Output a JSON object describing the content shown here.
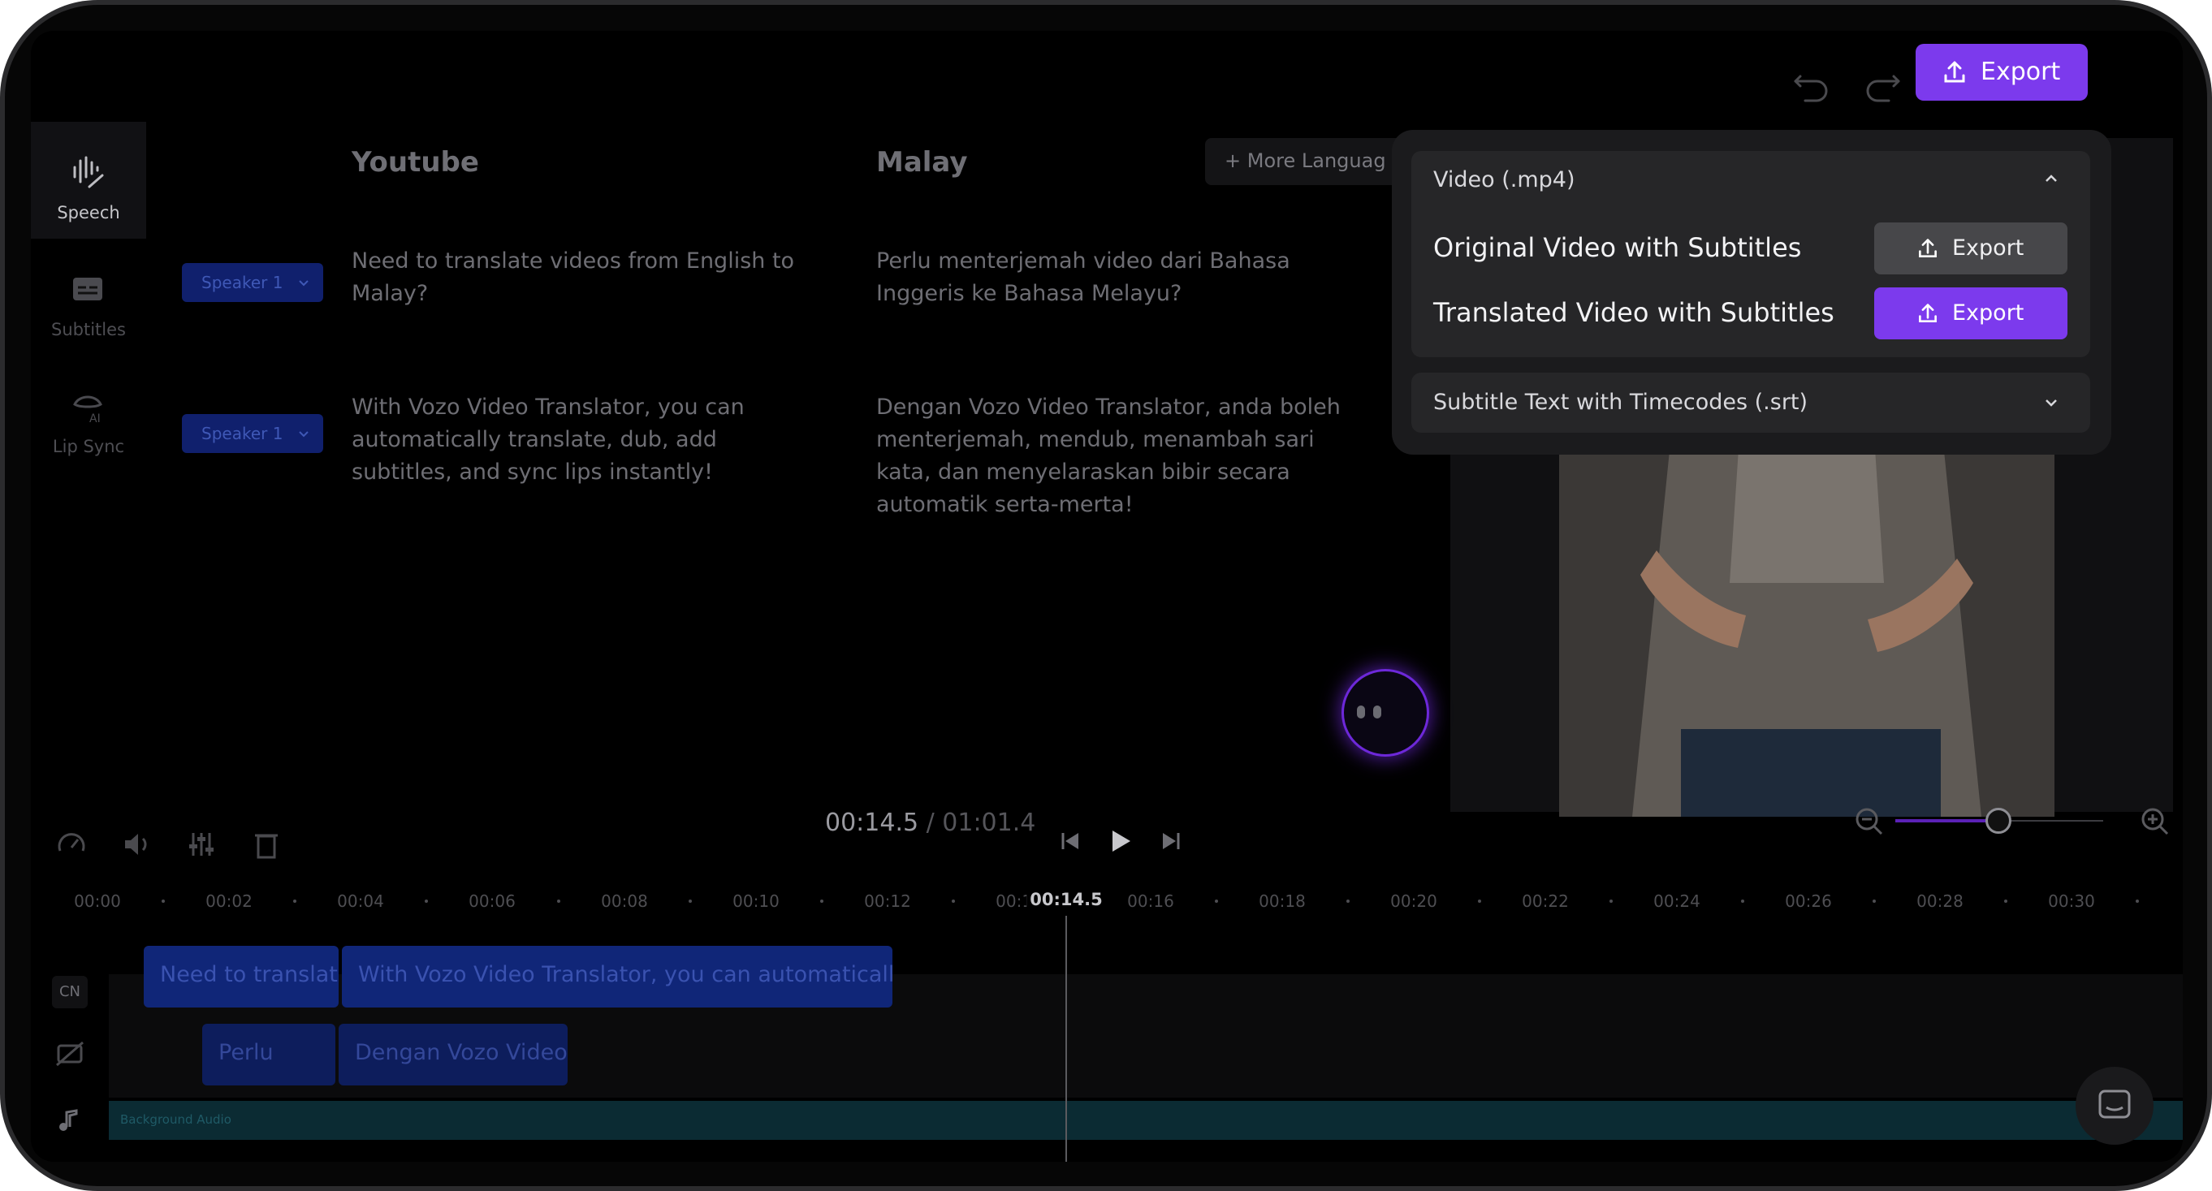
{
  "toolbar": {
    "export_label": "Export"
  },
  "rail": {
    "items": [
      {
        "label": "Speech",
        "icon": "speech-icon"
      },
      {
        "label": "Subtitles",
        "icon": "subtitles-icon"
      },
      {
        "label": "Lip Sync",
        "icon": "lip-sync-icon"
      }
    ]
  },
  "editor": {
    "source_column": "Youtube",
    "target_column": "Malay",
    "more_languages": "More Languag",
    "rows": [
      {
        "speaker": "Speaker 1",
        "source": "Need to translate videos from English to Malay?",
        "target": "Perlu menterjemah video dari Bahasa Inggeris ke Bahasa Melayu?"
      },
      {
        "speaker": "Speaker 1",
        "source": "With Vozo Video Translator, you can automatically translate, dub, add subtitles, and sync lips instantly!",
        "target": "Dengan Vozo Video Translator, anda boleh menterjemah, mendub, menambah sari kata, dan menyelaraskan bibir secara automatik serta-merta!"
      }
    ]
  },
  "export_menu": {
    "video_section": "Video (.mp4)",
    "options": [
      {
        "label": "Original Video with Subtitles",
        "button": "Export"
      },
      {
        "label": "Translated Video with Subtitles",
        "button": "Export"
      }
    ],
    "srt_section": "Subtitle Text with Timecodes (.srt)"
  },
  "player": {
    "current_time": "00:14.5",
    "separator": " / ",
    "total_time": "01:01.4",
    "zoom_level": 0.5
  },
  "ruler": {
    "ticks": [
      "00:00",
      "00:02",
      "00:04",
      "00:06",
      "00:08",
      "00:10",
      "00:12",
      "00:14",
      "00:16",
      "00:18",
      "00:20",
      "00:22",
      "00:24",
      "00:26",
      "00:28",
      "00:30"
    ],
    "playhead_label": "00:14.5"
  },
  "tracks": {
    "track1_label": "CN",
    "track1_clips": [
      "Need to translate",
      "With Vozo Video Translator, you can automatically"
    ],
    "track2_clips": [
      "Perlu",
      "Dengan Vozo Video"
    ],
    "audio_label": "Background Audio"
  },
  "colors": {
    "accent": "#7c3aed",
    "background": "#000000"
  }
}
